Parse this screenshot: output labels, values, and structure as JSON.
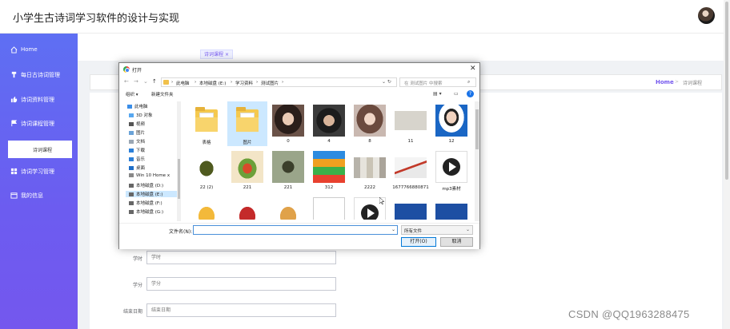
{
  "app": {
    "title": "小学生古诗词学习软件的设计与实现"
  },
  "sidebar": {
    "items": [
      {
        "label": "Home",
        "icon": "home-icon"
      },
      {
        "label": "每日古诗词管理",
        "icon": "pin-icon"
      },
      {
        "label": "诗词资料管理",
        "icon": "thumb-icon"
      },
      {
        "label": "诗词课程管理",
        "icon": "flag-icon"
      },
      {
        "label": "诗词学习管理",
        "icon": "grid-icon"
      },
      {
        "label": "我的信息",
        "icon": "calendar-icon"
      }
    ],
    "sub_item": "诗词课程"
  },
  "tabs": {
    "active": "诗词课程"
  },
  "breadcrumb": {
    "home": "Home",
    "current": "诗词课程"
  },
  "form": {
    "fields": [
      {
        "label": "学时",
        "placeholder": "学时"
      },
      {
        "label": "学分",
        "placeholder": "学分"
      },
      {
        "label": "结束日期",
        "placeholder": "结束日期"
      }
    ]
  },
  "dialog": {
    "title": "打开",
    "path": [
      "此电脑",
      "本地磁盘 (E:)",
      "学习资料",
      "测试图片"
    ],
    "search_placeholder": "在 测试图片 中搜索",
    "toolbar": {
      "organize": "组织 ▾",
      "new_folder": "新建文件夹"
    },
    "nav": [
      "此电脑",
      "3D 对象",
      "视频",
      "图片",
      "文档",
      "下载",
      "音乐",
      "桌面",
      "Win 10 Home x",
      "本地磁盘 (D:)",
      "本地磁盘 (E:)",
      "本地磁盘 (F:)",
      "本地磁盘 (G:)"
    ],
    "files": [
      {
        "name": "表格"
      },
      {
        "name": "图片"
      },
      {
        "name": "0"
      },
      {
        "name": "4"
      },
      {
        "name": "8"
      },
      {
        "name": "11"
      },
      {
        "name": "12"
      },
      {
        "name": "22 (2)"
      },
      {
        "name": "221"
      },
      {
        "name": "221"
      },
      {
        "name": "312"
      },
      {
        "name": "2222"
      },
      {
        "name": "1677766880871"
      },
      {
        "name": "mp3素材"
      },
      {
        "name": ""
      },
      {
        "name": ""
      },
      {
        "name": ""
      },
      {
        "name": ""
      },
      {
        "name": ""
      },
      {
        "name": ""
      },
      {
        "name": ""
      }
    ],
    "filename_label": "文件名(N):",
    "filename_value": "",
    "filetype": "所有文件",
    "open_button": "打开(O)",
    "cancel_button": "取消"
  },
  "watermark": "CSDN @QQ1963288475"
}
